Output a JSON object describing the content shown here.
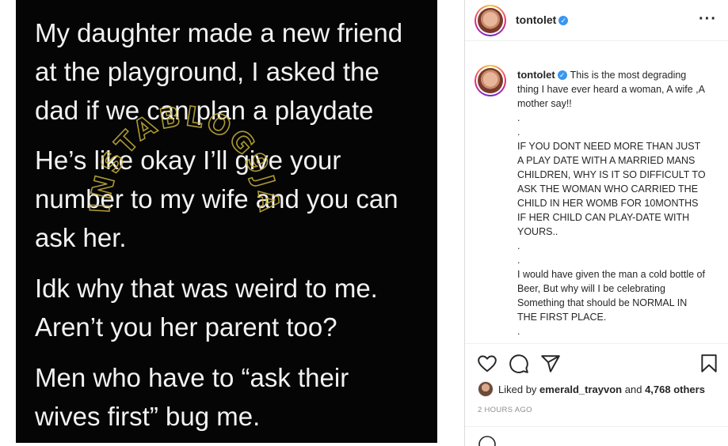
{
  "post": {
    "image_text": [
      "My daughter made a new friend",
      "at the playground, I asked the",
      "dad if we can plan a playdate",
      "He’s like okay I’ll give your",
      "number to my wife and you can",
      "ask her.",
      "Idk why that was weird to me.",
      "Aren’t you her parent too?",
      "Men who have to “ask their",
      "wives first” bug me."
    ],
    "watermark_text": "INSTABLOG9JA"
  },
  "header": {
    "username": "tontolet",
    "verified_icon": "verified-badge-icon",
    "more_icon": "more-options-icon"
  },
  "caption": {
    "username": "tontolet",
    "lines": [
      "This is the most degrading thing I have ever heard a woman, A wife ,A mother say!!",
      ".",
      ".",
      "IF YOU DONT NEED MORE THAN JUST A PLAY DATE WITH A MARRIED MANS CHILDREN, WHY IS IT SO DIFFICULT TO ASK THE WOMAN WHO CARRIED THE CHILD IN HER WOMB FOR 10MONTHS IF HER CHILD CAN PLAY-DATE WITH YOURS..",
      ".",
      ".",
      "I would have given the man a cold bottle of Beer, But why will I be celebrating Something that should be NORMAL IN THE FIRST PLACE.",
      "."
    ]
  },
  "actions": {
    "icons": [
      "heart-icon",
      "comment-icon",
      "share-icon",
      "bookmark-icon"
    ]
  },
  "likes": {
    "prefix": "Liked by",
    "user": "emerald_trayvon",
    "joiner": "and",
    "others": "4,768 others"
  },
  "timestamp": "2 HOURS AGO",
  "colors": {
    "verified": "#3897f0",
    "watermark": "#c9b23a"
  }
}
